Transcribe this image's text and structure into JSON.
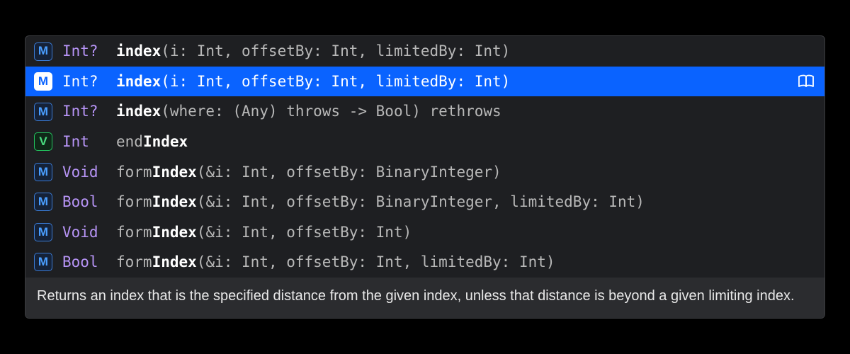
{
  "badge_labels": {
    "M": "M",
    "V": "V"
  },
  "items": [
    {
      "kind": "M",
      "ret": "Int?",
      "sig_pre": "",
      "sig_bold": "index",
      "sig_post": "(i: Int, offsetBy: Int, limitedBy: Int)",
      "selected": false
    },
    {
      "kind": "M",
      "ret": "Int?",
      "sig_pre": "",
      "sig_bold": "index",
      "sig_post": "(i: Int, offsetBy: Int, limitedBy: Int)",
      "selected": true
    },
    {
      "kind": "M",
      "ret": "Int?",
      "sig_pre": "",
      "sig_bold": "index",
      "sig_post": "(where: (Any) throws -> Bool) rethrows",
      "selected": false
    },
    {
      "kind": "V",
      "ret": "Int",
      "sig_pre": "end",
      "sig_bold": "Index",
      "sig_post": "",
      "selected": false
    },
    {
      "kind": "M",
      "ret": "Void",
      "sig_pre": "form",
      "sig_bold": "Index",
      "sig_post": "(&i: Int, offsetBy: BinaryInteger)",
      "selected": false
    },
    {
      "kind": "M",
      "ret": "Bool",
      "sig_pre": "form",
      "sig_bold": "Index",
      "sig_post": "(&i: Int, offsetBy: BinaryInteger, limitedBy: Int)",
      "selected": false
    },
    {
      "kind": "M",
      "ret": "Void",
      "sig_pre": "form",
      "sig_bold": "Index",
      "sig_post": "(&i: Int, offsetBy: Int)",
      "selected": false
    },
    {
      "kind": "M",
      "ret": "Bool",
      "sig_pre": "form",
      "sig_bold": "Index",
      "sig_post": "(&i: Int, offsetBy: Int, limitedBy: Int)",
      "selected": false
    }
  ],
  "description": "Returns an index that is the specified distance from the given index, unless that distance is beyond a given limiting index."
}
